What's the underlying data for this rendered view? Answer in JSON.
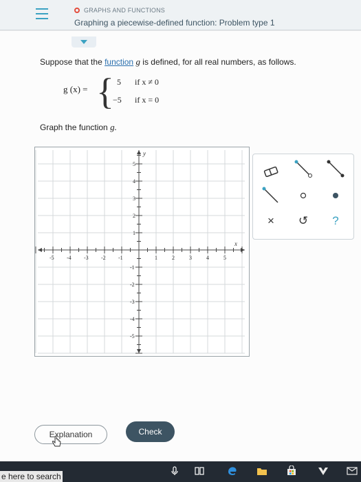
{
  "header": {
    "topic": "GRAPHS AND FUNCTIONS",
    "problem_title": "Graphing a piecewise-defined function: Problem type 1"
  },
  "prompt": {
    "lead": "Suppose that the ",
    "link": "function",
    "variable": "g",
    "rest": " is defined, for all real numbers, as follows."
  },
  "function_def": {
    "lhs": "g (x) =",
    "cases": [
      {
        "value": "5",
        "condition": "if x ≠ 0"
      },
      {
        "value": "−5",
        "condition": "if x = 0"
      }
    ]
  },
  "graph_prompt": {
    "text": "Graph the function ",
    "variable": "g."
  },
  "graph": {
    "x_axis_label": "x",
    "y_axis_label": "y",
    "x_ticks": [
      "-5",
      "-4",
      "-3",
      "-2",
      "-1",
      "1",
      "2",
      "3",
      "4",
      "5"
    ],
    "y_ticks": [
      "5",
      "4",
      "3",
      "2",
      "1",
      "-1",
      "-2",
      "-3",
      "-4",
      "-5"
    ]
  },
  "tools": {
    "undo_symbol": "↺",
    "clear_symbol": "×",
    "help_symbol": "?"
  },
  "buttons": {
    "explanation": "Explanation",
    "check": "Check"
  },
  "taskbar": {
    "search_text": "e here to search"
  },
  "colors": {
    "accent": "#3ba2c2",
    "header_text": "#3d5463",
    "check_button": "#3d5463"
  }
}
